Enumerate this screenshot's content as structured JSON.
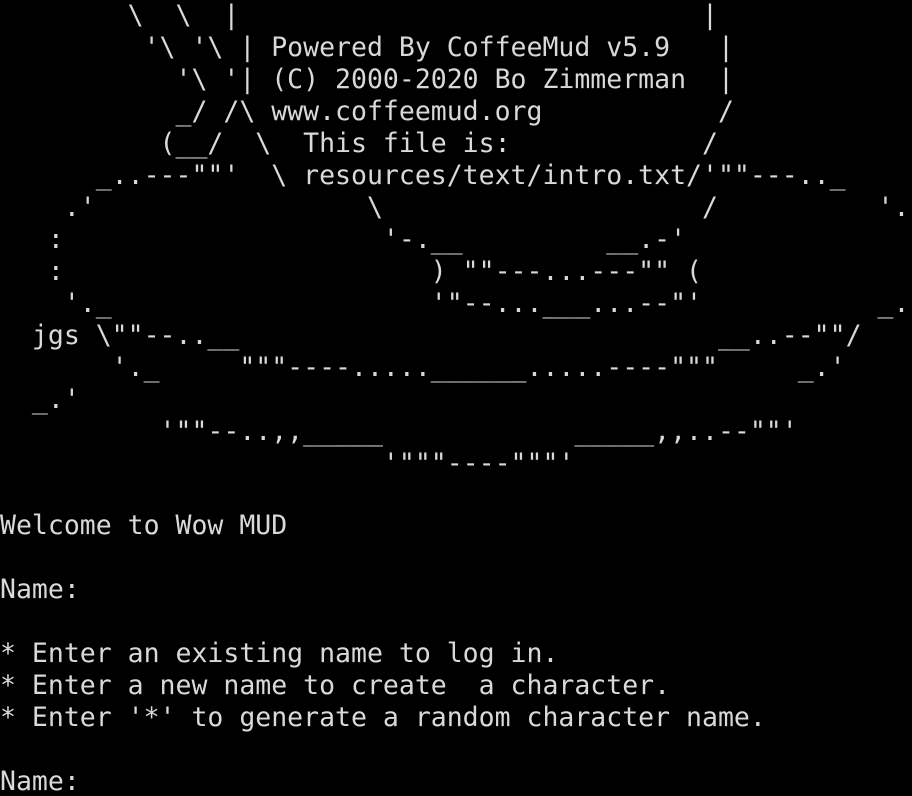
{
  "theme": {
    "background": "#000000",
    "foreground": "#d9d9d9"
  },
  "banner": [
    "        \\  \\  |                             |",
    "         '\\ '\\ | Powered By CoffeeMud v5.9   |",
    "           '\\ '| (C) 2000-2020 Bo Zimmerman  |",
    "           _/ /\\ www.coffeemud.org           /",
    "          (__/  \\  This file is:            /",
    "      _..---\"\"'  \\ resources/text/intro.txt/'\"\"---.._",
    "    .'                 \\                    /          '.",
    "   :                    '-.__         __.-'              :",
    "   :                       ) \"\"---...---\"\" (              :",
    "    '._                    '\"--...___...--\"'           _.'",
    "  jgs \\\"\"--..__                              __..--\"\"/",
    "       '._     \"\"\"----.....______.....----\"\"\"     _.'",
    "  _.'",
    "          '\"\"--..,,_____            _____,,..--\"\"'",
    "                        '\"\"\"----\"\"\"'"
  ],
  "welcome": "Welcome to Wow MUD",
  "prompt_label": "Name:",
  "instructions": [
    "* Enter an existing name to log in.",
    "* Enter a new name to create  a character.",
    "* Enter '*' to generate a random character name."
  ],
  "final_prompt": "Name:"
}
